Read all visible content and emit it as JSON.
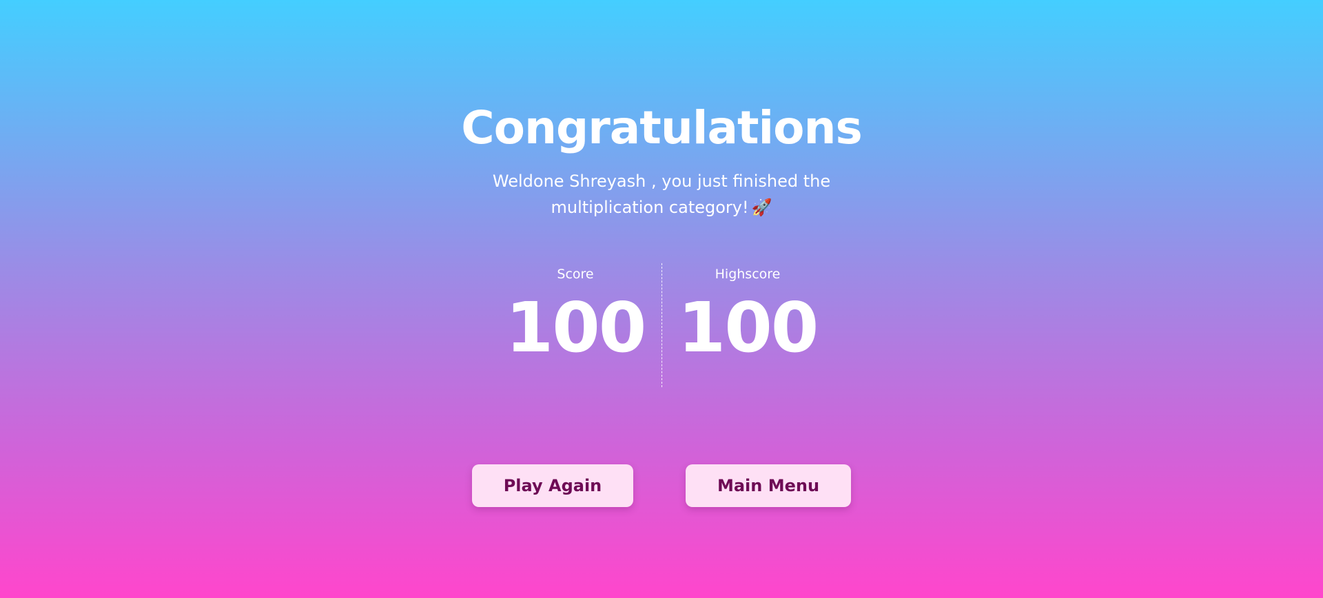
{
  "heading": {
    "title": "Congratulations",
    "message": "Weldone Shreyash , you just finished the multiplication category!",
    "rocket_emoji": "🚀"
  },
  "stats": {
    "score_label": "Score",
    "score_value": "100",
    "highscore_label": "Highscore",
    "highscore_value": "100"
  },
  "actions": {
    "play_again_label": "Play Again",
    "main_menu_label": "Main Menu"
  },
  "colors": {
    "gradient_top": "#44CEFF",
    "gradient_bottom": "#FF46CC",
    "button_background": "#FEE0F5",
    "button_text": "#6E0B55",
    "text": "#FFFFFF"
  },
  "icons": {
    "rocket": "rocket-icon"
  }
}
